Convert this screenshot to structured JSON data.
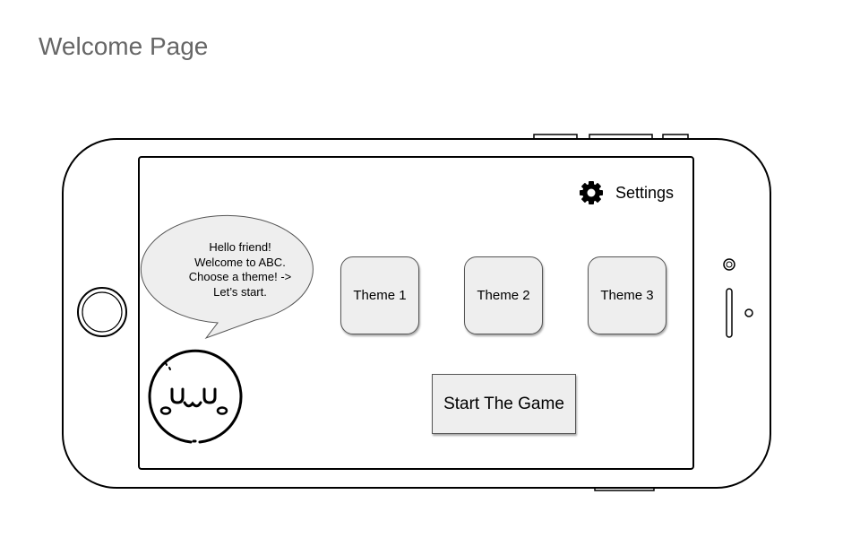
{
  "page": {
    "title": "Welcome Page"
  },
  "settings": {
    "label": "Settings",
    "icon": "gear-icon"
  },
  "speech_bubble": {
    "lines": [
      "Hello friend!",
      "Welcome to ABC.",
      "Choose a theme! ->",
      "Let’s start."
    ]
  },
  "themes": [
    {
      "label": "Theme 1"
    },
    {
      "label": "Theme 2"
    },
    {
      "label": "Theme 3"
    }
  ],
  "start_button": {
    "label": "Start The Game"
  },
  "mascot": {
    "icon": "kawaii-face-icon"
  },
  "colors": {
    "title_text": "#666666",
    "button_fill": "#eeeeee",
    "bubble_fill": "#eeeeee",
    "outline": "#000000"
  }
}
